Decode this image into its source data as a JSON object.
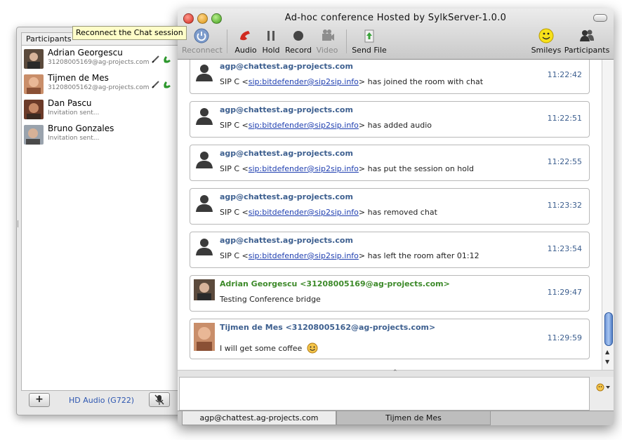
{
  "window": {
    "title": "Ad-hoc conference Hosted by SylkServer-1.0.0"
  },
  "toolbar": {
    "reconnect": "Reconnect",
    "audio": "Audio",
    "hold": "Hold",
    "record": "Record",
    "video": "Video",
    "send_file": "Send File",
    "smileys": "Smileys",
    "participants": "Participants"
  },
  "tooltip": "Reconnect the Chat session",
  "participants_panel": {
    "tab_label": "Participants",
    "items": [
      {
        "name": "Adrian Georgescu",
        "sub": "31208005169@ag-projects.com"
      },
      {
        "name": "Tijmen  de Mes",
        "sub": "31208005162@ag-projects.com"
      },
      {
        "name": "Dan Pascu",
        "sub": "Invitation sent..."
      },
      {
        "name": "Bruno Gonzales",
        "sub": "Invitation sent..."
      }
    ],
    "add_label": "+",
    "codec": "HD Audio (G722)"
  },
  "messages": [
    {
      "sender": "agp@chattest.ag-projects.com",
      "prefix": "SIP C <",
      "link": "sip:bitdefender@sip2sip.info",
      "suffix": "> has joined the room with chat",
      "time": "11:22:42"
    },
    {
      "sender": "agp@chattest.ag-projects.com",
      "prefix": "SIP C <",
      "link": "sip:bitdefender@sip2sip.info",
      "suffix": "> has added audio",
      "time": "11:22:51"
    },
    {
      "sender": "agp@chattest.ag-projects.com",
      "prefix": "SIP C <",
      "link": "sip:bitdefender@sip2sip.info",
      "suffix": "> has put the session on hold",
      "time": "11:22:55"
    },
    {
      "sender": "agp@chattest.ag-projects.com",
      "prefix": "SIP C <",
      "link": "sip:bitdefender@sip2sip.info",
      "suffix": "> has removed chat",
      "time": "11:23:32"
    },
    {
      "sender": "agp@chattest.ag-projects.com",
      "prefix": "SIP C <",
      "link": "sip:bitdefender@sip2sip.info",
      "suffix": "> has left the room after 01:12",
      "time": "11:23:54"
    },
    {
      "sender": "Adrian Georgescu <31208005169@ag-projects.com>",
      "text": "Testing Conference bridge",
      "time": "11:29:47"
    },
    {
      "sender": "Tijmen de Mes <31208005162@ag-projects.com>",
      "text": "I will get some coffee",
      "time": "11:29:59"
    }
  ],
  "tabs": [
    {
      "label": "agp@chattest.ag-projects.com"
    },
    {
      "label": "Tijmen de Mes"
    }
  ],
  "colors": {
    "sender_system": "#3d5f8f",
    "sender_user": "#3d8a2a",
    "link": "#1f3fb0",
    "codec": "#2d56b0"
  }
}
